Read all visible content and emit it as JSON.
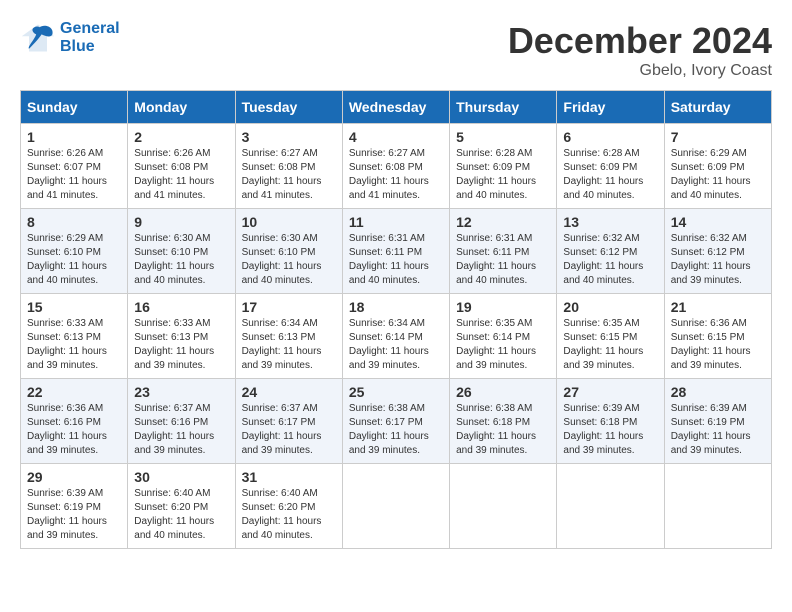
{
  "header": {
    "logo_line1": "General",
    "logo_line2": "Blue",
    "month_title": "December 2024",
    "subtitle": "Gbelo, Ivory Coast"
  },
  "days_of_week": [
    "Sunday",
    "Monday",
    "Tuesday",
    "Wednesday",
    "Thursday",
    "Friday",
    "Saturday"
  ],
  "weeks": [
    [
      {
        "day": 1,
        "rise": "6:26 AM",
        "set": "6:07 PM",
        "daylight": "11 hours and 41 minutes."
      },
      {
        "day": 2,
        "rise": "6:26 AM",
        "set": "6:08 PM",
        "daylight": "11 hours and 41 minutes."
      },
      {
        "day": 3,
        "rise": "6:27 AM",
        "set": "6:08 PM",
        "daylight": "11 hours and 41 minutes."
      },
      {
        "day": 4,
        "rise": "6:27 AM",
        "set": "6:08 PM",
        "daylight": "11 hours and 41 minutes."
      },
      {
        "day": 5,
        "rise": "6:28 AM",
        "set": "6:09 PM",
        "daylight": "11 hours and 40 minutes."
      },
      {
        "day": 6,
        "rise": "6:28 AM",
        "set": "6:09 PM",
        "daylight": "11 hours and 40 minutes."
      },
      {
        "day": 7,
        "rise": "6:29 AM",
        "set": "6:09 PM",
        "daylight": "11 hours and 40 minutes."
      }
    ],
    [
      {
        "day": 8,
        "rise": "6:29 AM",
        "set": "6:10 PM",
        "daylight": "11 hours and 40 minutes."
      },
      {
        "day": 9,
        "rise": "6:30 AM",
        "set": "6:10 PM",
        "daylight": "11 hours and 40 minutes."
      },
      {
        "day": 10,
        "rise": "6:30 AM",
        "set": "6:10 PM",
        "daylight": "11 hours and 40 minutes."
      },
      {
        "day": 11,
        "rise": "6:31 AM",
        "set": "6:11 PM",
        "daylight": "11 hours and 40 minutes."
      },
      {
        "day": 12,
        "rise": "6:31 AM",
        "set": "6:11 PM",
        "daylight": "11 hours and 40 minutes."
      },
      {
        "day": 13,
        "rise": "6:32 AM",
        "set": "6:12 PM",
        "daylight": "11 hours and 40 minutes."
      },
      {
        "day": 14,
        "rise": "6:32 AM",
        "set": "6:12 PM",
        "daylight": "11 hours and 39 minutes."
      }
    ],
    [
      {
        "day": 15,
        "rise": "6:33 AM",
        "set": "6:13 PM",
        "daylight": "11 hours and 39 minutes."
      },
      {
        "day": 16,
        "rise": "6:33 AM",
        "set": "6:13 PM",
        "daylight": "11 hours and 39 minutes."
      },
      {
        "day": 17,
        "rise": "6:34 AM",
        "set": "6:13 PM",
        "daylight": "11 hours and 39 minutes."
      },
      {
        "day": 18,
        "rise": "6:34 AM",
        "set": "6:14 PM",
        "daylight": "11 hours and 39 minutes."
      },
      {
        "day": 19,
        "rise": "6:35 AM",
        "set": "6:14 PM",
        "daylight": "11 hours and 39 minutes."
      },
      {
        "day": 20,
        "rise": "6:35 AM",
        "set": "6:15 PM",
        "daylight": "11 hours and 39 minutes."
      },
      {
        "day": 21,
        "rise": "6:36 AM",
        "set": "6:15 PM",
        "daylight": "11 hours and 39 minutes."
      }
    ],
    [
      {
        "day": 22,
        "rise": "6:36 AM",
        "set": "6:16 PM",
        "daylight": "11 hours and 39 minutes."
      },
      {
        "day": 23,
        "rise": "6:37 AM",
        "set": "6:16 PM",
        "daylight": "11 hours and 39 minutes."
      },
      {
        "day": 24,
        "rise": "6:37 AM",
        "set": "6:17 PM",
        "daylight": "11 hours and 39 minutes."
      },
      {
        "day": 25,
        "rise": "6:38 AM",
        "set": "6:17 PM",
        "daylight": "11 hours and 39 minutes."
      },
      {
        "day": 26,
        "rise": "6:38 AM",
        "set": "6:18 PM",
        "daylight": "11 hours and 39 minutes."
      },
      {
        "day": 27,
        "rise": "6:39 AM",
        "set": "6:18 PM",
        "daylight": "11 hours and 39 minutes."
      },
      {
        "day": 28,
        "rise": "6:39 AM",
        "set": "6:19 PM",
        "daylight": "11 hours and 39 minutes."
      }
    ],
    [
      {
        "day": 29,
        "rise": "6:39 AM",
        "set": "6:19 PM",
        "daylight": "11 hours and 39 minutes."
      },
      {
        "day": 30,
        "rise": "6:40 AM",
        "set": "6:20 PM",
        "daylight": "11 hours and 40 minutes."
      },
      {
        "day": 31,
        "rise": "6:40 AM",
        "set": "6:20 PM",
        "daylight": "11 hours and 40 minutes."
      },
      null,
      null,
      null,
      null
    ]
  ]
}
